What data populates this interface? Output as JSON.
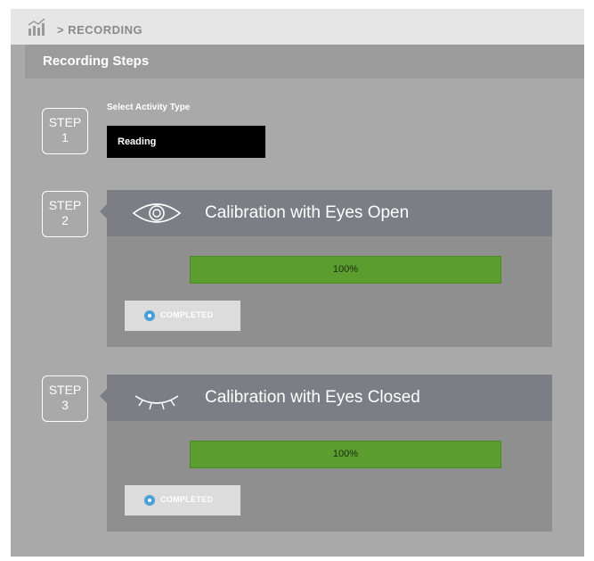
{
  "breadcrumb": {
    "text": "> RECORDING"
  },
  "panel": {
    "title": "Recording Steps"
  },
  "steps": [
    {
      "label": "STEP",
      "number": "1"
    },
    {
      "label": "STEP",
      "number": "2"
    },
    {
      "label": "STEP",
      "number": "3"
    }
  ],
  "activity": {
    "label": "Select Activity Type",
    "value": "Reading"
  },
  "calibrations": [
    {
      "title": "Calibration with Eyes Open",
      "icon": "eye-open-icon",
      "progress": 100,
      "progress_text": "100%",
      "status": "COMPLETED"
    },
    {
      "title": "Calibration with Eyes Closed",
      "icon": "eye-closed-icon",
      "progress": 100,
      "progress_text": "100%",
      "status": "COMPLETED"
    }
  ],
  "colors": {
    "progress": "#5b9d2e",
    "status_dot": "#4aa0d8",
    "select_bg": "#000000"
  }
}
